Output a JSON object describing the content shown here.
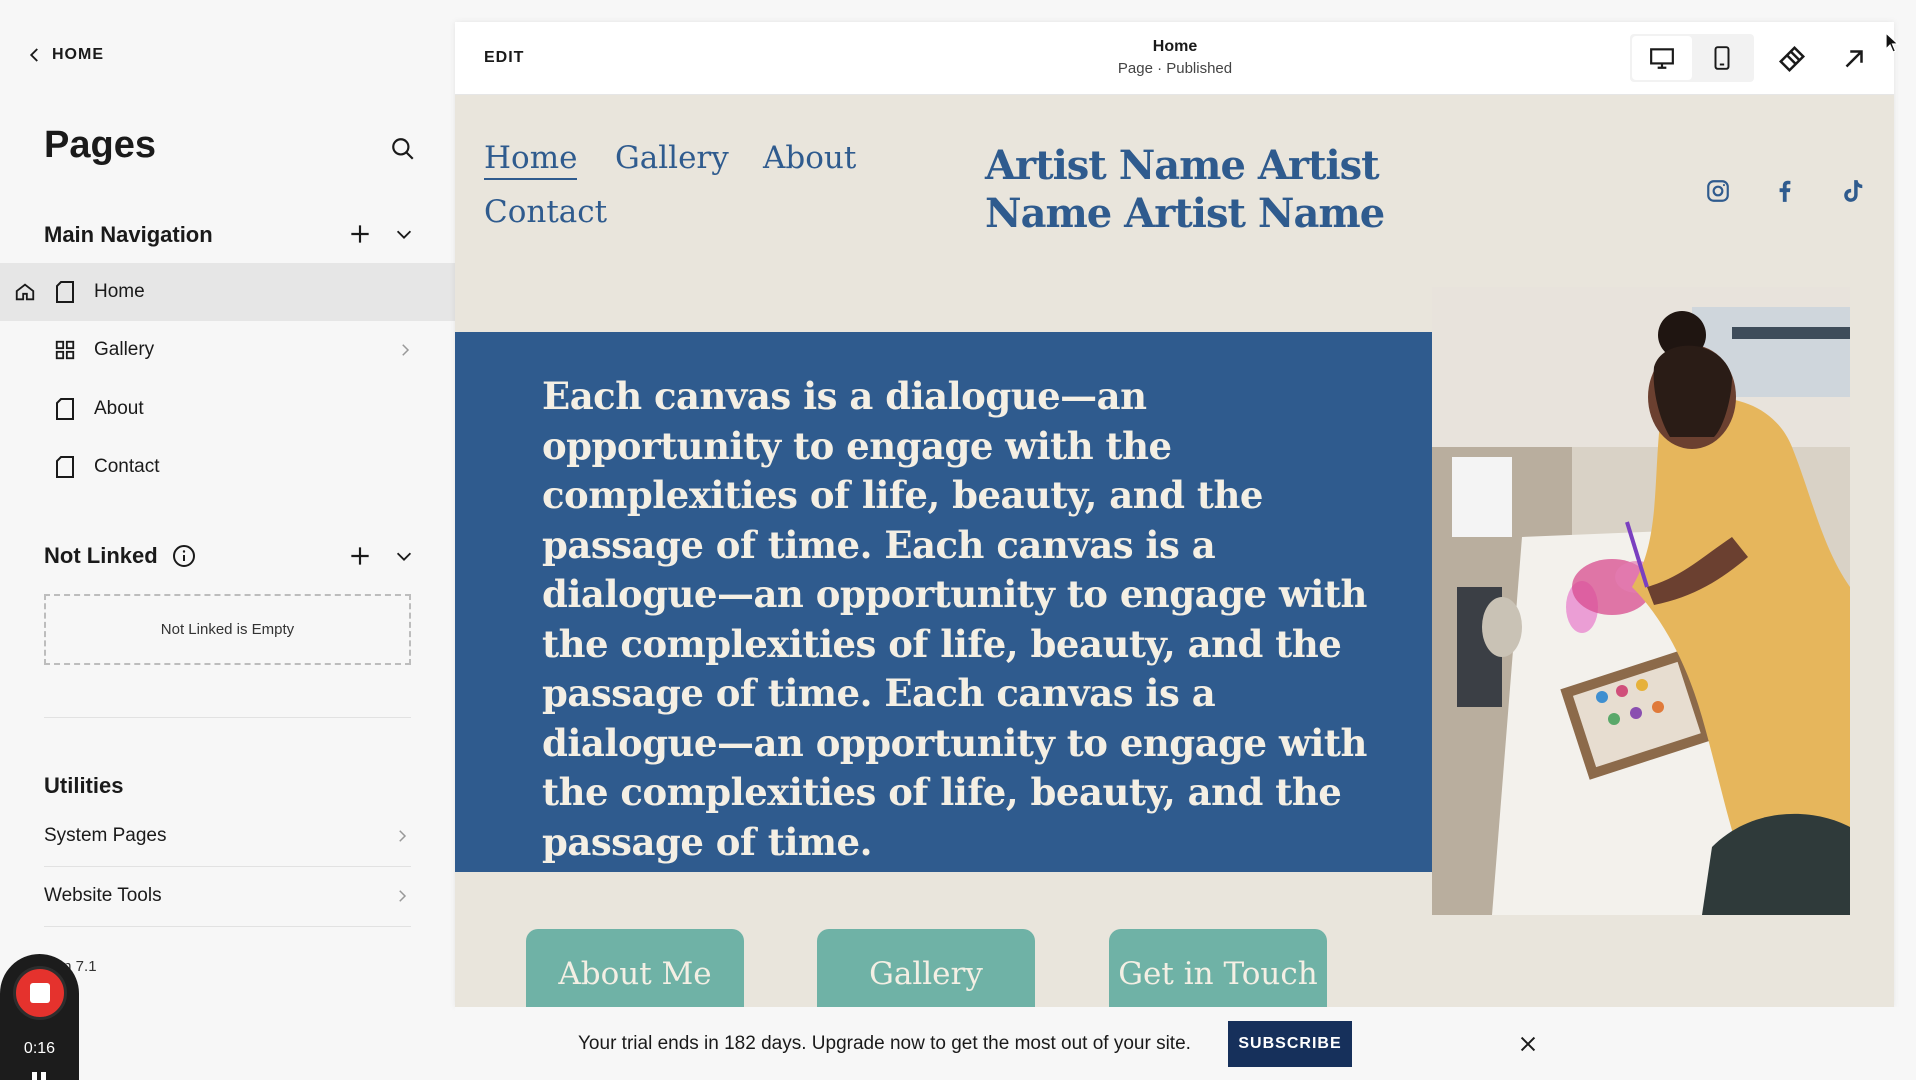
{
  "sidebar": {
    "back_label": "HOME",
    "title": "Pages",
    "main_nav_title": "Main Navigation",
    "main_nav_items": [
      {
        "label": "Home"
      },
      {
        "label": "Gallery"
      },
      {
        "label": "About"
      },
      {
        "label": "Contact"
      }
    ],
    "not_linked_title": "Not Linked",
    "not_linked_empty": "Not Linked is Empty",
    "utilities_title": "Utilities",
    "utilities_items": [
      {
        "label": "System Pages"
      },
      {
        "label": "Website Tools"
      }
    ],
    "version": "sion 7.1"
  },
  "recorder": {
    "time": "0:16"
  },
  "editor_bar": {
    "edit_label": "EDIT",
    "page_title": "Home",
    "page_status": "Page · Published"
  },
  "site": {
    "nav": [
      "Home",
      "Gallery",
      "About",
      "Contact"
    ],
    "logo_text": "Artist Name Artist Name Artist Name",
    "hero_text": "Each canvas is a dialogue—an opportunity to engage with the complexities of life, beauty, and the passage of time. Each canvas is a dialogue—an opportunity to engage with the complexities of life, beauty, and the passage of time. Each canvas is a dialogue—an opportunity to engage with the complexities of life, beauty, and the passage of time.",
    "buttons": [
      "About Me",
      "Gallery",
      "Get in Touch"
    ]
  },
  "banner": {
    "text": "Your trial ends in 182 days. Upgrade now to get the most out of your site.",
    "subscribe_label": "SUBSCRIBE"
  },
  "colors": {
    "brand_blue": "#2f5b8e",
    "page_bg": "#e9e5dc",
    "cta_teal": "#6fb2a6",
    "subscribe_navy": "#16305b",
    "record_red": "#e5322d"
  }
}
